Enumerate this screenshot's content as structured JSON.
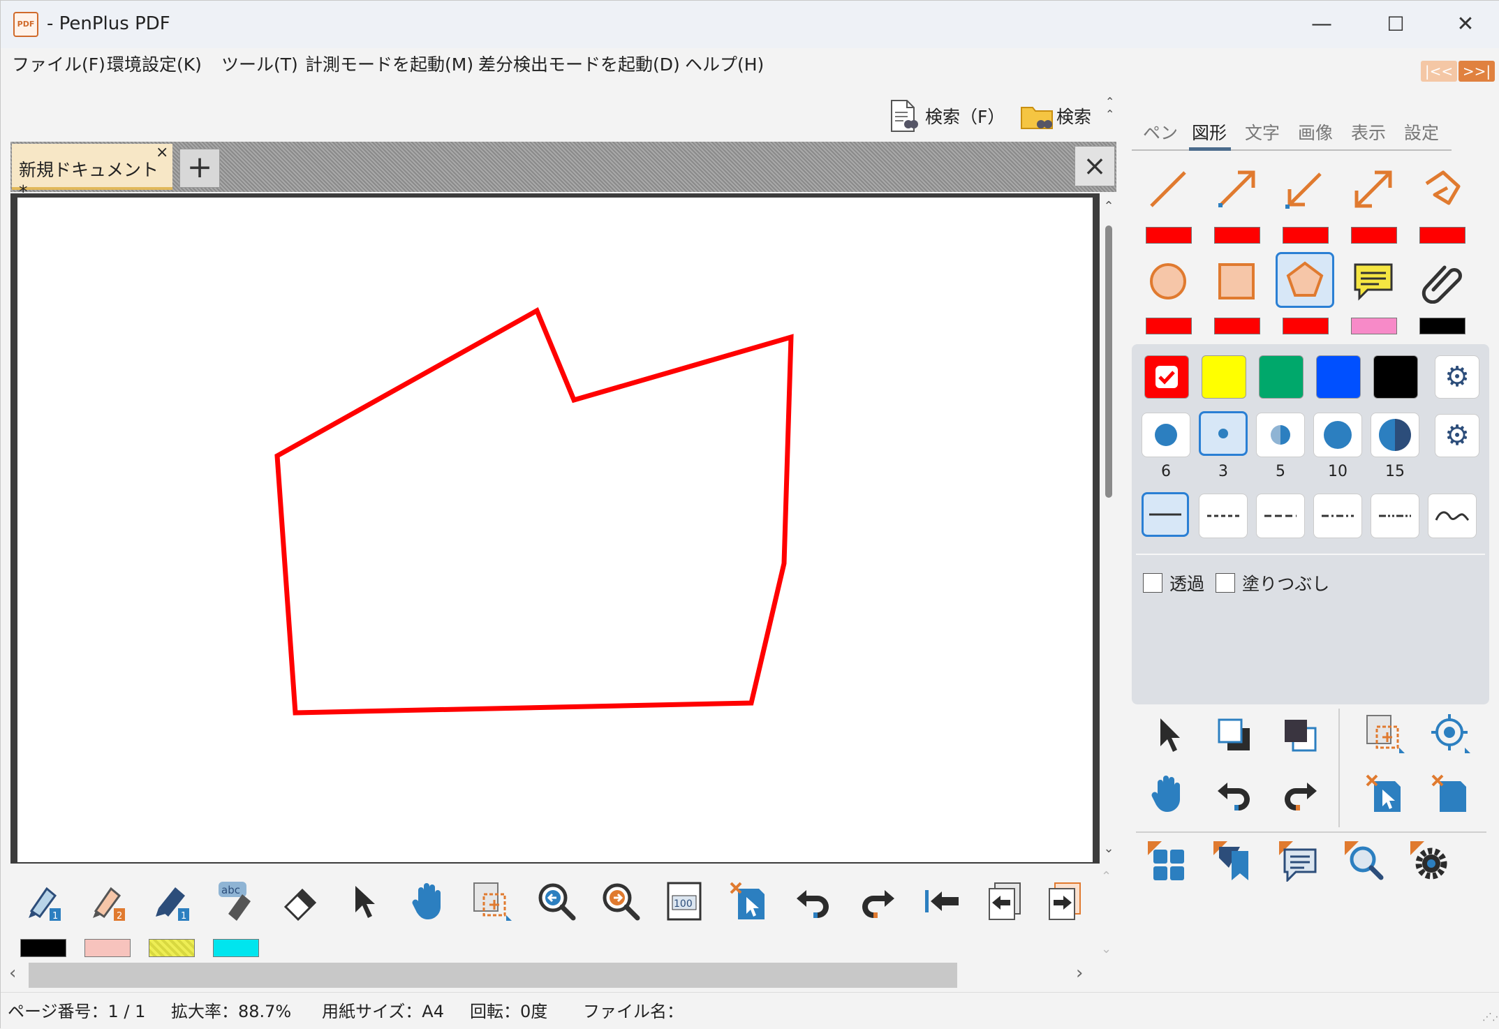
{
  "window": {
    "title": "- PenPlus PDF",
    "app_icon_text": "PDF",
    "controls": {
      "minimize": "—",
      "maximize": "☐",
      "close": "✕"
    }
  },
  "menu": {
    "items": [
      "ファイル(F)",
      "環境設定(K)",
      "ツール(T)",
      "計測モードを起動(M)",
      "差分検出モードを起動(D)",
      "ヘルプ(H)"
    ],
    "panel_toggle": {
      "left": "|<<",
      "right": ">>|"
    }
  },
  "search": {
    "doc_label": "検索（F）",
    "folder_label": "検索"
  },
  "tabs": {
    "document_tab_label": "新規ドキュメント *",
    "close_glyph": "×",
    "add_glyph": "+",
    "close_doc_glyph": "×"
  },
  "canvas": {
    "shape_color": "#ff0000",
    "polygon_points_pdf": "Pentagon-like freehand polygon drawn in red"
  },
  "bottom_toolbar": {
    "tools": [
      "pen-1-icon",
      "pen-2-icon",
      "highlighter-1-icon",
      "text-pen-icon",
      "eraser-icon",
      "select-arrow-icon",
      "hand-icon",
      "area-select-icon",
      "zoom-out-icon",
      "zoom-in-icon",
      "actual-size-icon",
      "delete-select-icon",
      "undo-icon",
      "redo-icon",
      "first-page-icon",
      "prev-page-icon",
      "next-page-icon"
    ],
    "actual_size_text": "100",
    "text_pen_text": "abc",
    "pen_colors": [
      "#000000",
      "#f7c3bd",
      "#eeee66",
      "#00e5ee"
    ]
  },
  "status": {
    "page": "ページ番号：1 / 1",
    "zoom": "拡大率：88.7%",
    "paper": "用紙サイズ：A4",
    "rotation": "回転：0度",
    "filename": "ファイル名："
  },
  "right_panel": {
    "tabs": [
      "ペン",
      "図形",
      "文字",
      "画像",
      "表示",
      "設定"
    ],
    "active_tab": "図形",
    "shapes_row1": [
      "line-icon",
      "arrow-end-icon",
      "arrow-start-icon",
      "arrow-both-icon",
      "polyline-icon"
    ],
    "shapes_row1_colors": [
      "#ff0000",
      "#ff0000",
      "#ff0000",
      "#ff0000",
      "#ff0000"
    ],
    "shapes_row2": [
      "circle-icon",
      "rectangle-icon",
      "polygon-icon",
      "comment-icon",
      "attachment-icon"
    ],
    "shapes_row2_colors": [
      "#ff0000",
      "#ff0000",
      "#ff0000",
      "#f78ac8",
      "#000000"
    ],
    "selected_shape": "polygon-icon",
    "colors": [
      "#ff0000",
      "#ffff00",
      "#00a86b",
      "#0050ff",
      "#000000"
    ],
    "selected_color": "#ff0000",
    "widths": [
      "6",
      "3",
      "5",
      "10",
      "15"
    ],
    "selected_width": "3",
    "line_styles": [
      "solid",
      "dash",
      "dash-long",
      "dash-dot",
      "dash-dot-dot",
      "wave"
    ],
    "selected_line_style": "solid",
    "transparent_label": "透過",
    "fill_label": "塗りつぶし",
    "transparent_checked": false,
    "fill_checked": false
  }
}
